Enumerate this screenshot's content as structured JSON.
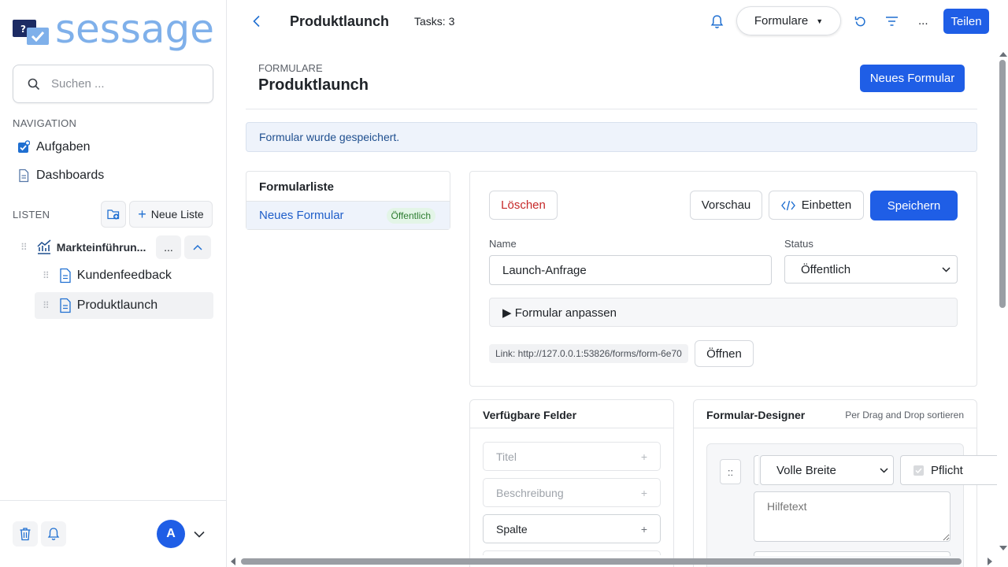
{
  "app": {
    "logo_text": "sessage"
  },
  "search": {
    "placeholder": "Suchen ..."
  },
  "navigation": {
    "label": "NAVIGATION",
    "items": [
      {
        "label": "Aufgaben",
        "icon": "tasks-icon"
      },
      {
        "label": "Dashboards",
        "icon": "document-icon"
      }
    ]
  },
  "lists": {
    "label": "LISTEN",
    "new_list_label": "Neue Liste",
    "group": {
      "label": "Markteinführun...",
      "more": "..."
    },
    "items": [
      {
        "label": "Kundenfeedback"
      },
      {
        "label": "Produktlaunch"
      }
    ]
  },
  "user": {
    "avatar_initial": "A"
  },
  "topbar": {
    "title": "Produktlaunch",
    "tasks": "Tasks: 3",
    "view_select": "Formulare",
    "more": "...",
    "share_label": "Teilen"
  },
  "page": {
    "section": "FORMULARE",
    "title": "Produktlaunch",
    "new_form_label": "Neues Formular",
    "alert": "Formular wurde gespeichert."
  },
  "form_list": {
    "title": "Formularliste",
    "items": [
      {
        "name": "Neues Formular",
        "badge": "Öffentlich"
      }
    ]
  },
  "editor": {
    "delete_label": "Löschen",
    "preview_label": "Vorschau",
    "embed_label": "Einbetten",
    "save_label": "Speichern",
    "name_label": "Name",
    "name_value": "Launch-Anfrage",
    "status_label": "Status",
    "status_value": "Öffentlich",
    "customize_label": "▶ Formular anpassen",
    "link_text": "Link: http://127.0.0.1:53826/forms/form-6e70",
    "open_label": "Öffnen"
  },
  "available_fields": {
    "title": "Verfügbare Felder",
    "items": [
      {
        "label": "Titel",
        "enabled": false
      },
      {
        "label": "Beschreibung",
        "enabled": false
      },
      {
        "label": "Spalte",
        "enabled": true
      }
    ],
    "add_symbol": "+"
  },
  "designer": {
    "title": "Formular-Designer",
    "hint": "Per Drag and Drop sortieren",
    "drag_symbol": "::",
    "width_value": "Volle Breite",
    "required_label": "Pflicht",
    "helptext_placeholder": "Hilfetext"
  },
  "colors": {
    "primary": "#1f5ee6",
    "danger": "#c62828",
    "success_badge_bg": "#e3f5e7",
    "success_badge_text": "#2e7d32",
    "alert_bg": "#eef3fb",
    "logo": "#7fb0ea"
  }
}
